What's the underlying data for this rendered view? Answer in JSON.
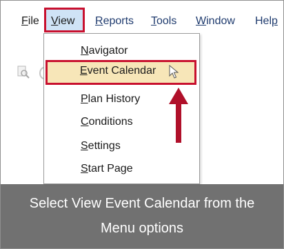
{
  "menubar": {
    "file": {
      "acc": "F",
      "rest": "ile"
    },
    "view": {
      "acc": "V",
      "rest": "iew"
    },
    "reports": {
      "acc": "R",
      "rest": "eports"
    },
    "tools": {
      "acc": "T",
      "rest": "ools"
    },
    "window": {
      "acc": "W",
      "rest": "indow"
    },
    "help": {
      "pre": "Hel",
      "acc": "p"
    }
  },
  "dropdown": {
    "navigator": {
      "acc": "N",
      "rest": "avigator"
    },
    "event_calendar": {
      "acc": "E",
      "rest": "vent Calendar"
    },
    "plan_history": {
      "acc": "P",
      "rest": "lan History"
    },
    "conditions": {
      "acc": "C",
      "rest": "onditions"
    },
    "settings": {
      "acc": "S",
      "rest": "ettings"
    },
    "start_page": {
      "acc": "S",
      "rest": "tart Page"
    }
  },
  "caption": {
    "line1": "Select View Event Calendar from the",
    "line2": "Menu options"
  },
  "colors": {
    "highlight_border": "#c8102e",
    "selected_bg": "#f7e6b8",
    "view_bg": "#cfe3f6",
    "caption_bg": "#5a5a5a"
  },
  "icons": [
    "print-preview-icon",
    "mouse-cursor-icon",
    "up-arrow-icon"
  ]
}
